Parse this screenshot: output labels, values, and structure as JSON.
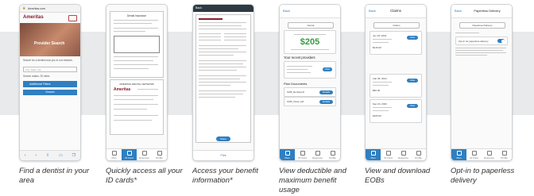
{
  "captions": [
    "Find a dentist in your area",
    "Quickly access all your ID cards*",
    "Access your benefit information*",
    "View deductible and maximum benefit usage",
    "View and download EOBs",
    "Opt-in to paperless delivery"
  ],
  "tab_labels": [
    "Plan",
    "ID Card",
    "Resource",
    "Profile"
  ],
  "phone1": {
    "url": "Ameritas.com",
    "logo": "Ameritas",
    "banner": "Provider Search",
    "search_placeholder": "City, State, Zip",
    "filters_label": "Additional Filters",
    "search_button": "Search"
  },
  "phone2": {
    "card1_title": "Dental Insurance",
    "card2_title": "AMERITAS DENTAL NETWORK",
    "brand": "Ameritas"
  },
  "phone3": {
    "back": "Back",
    "share_label": "Share",
    "footer_label": "Print"
  },
  "phone4": {
    "back": "Back",
    "select_value": "Dental",
    "amount": "$205",
    "providers_heading": "Your recent providers",
    "view_label": "View",
    "docs_heading": "Plan Documents",
    "doc1": "SOB_Dental.pdf",
    "doc2": "SOB_Vision.pdf",
    "details_label": "Details"
  },
  "phone5": {
    "back": "Back",
    "title": "Claims",
    "select_value": "Claims",
    "view_label": "View",
    "claims": [
      {
        "date": "Jun 18, 2024",
        "amount": "$215.00"
      },
      {
        "date": "Feb 05, 2024",
        "amount": "$82.00"
      },
      {
        "date": "Sep 24, 2023",
        "amount": "$105.00"
      }
    ]
  },
  "phone6": {
    "back": "Back",
    "title": "Paperless Delivery",
    "select_value": "Paperless Delivery",
    "option_label": "Opt-in for paperless delivery"
  }
}
